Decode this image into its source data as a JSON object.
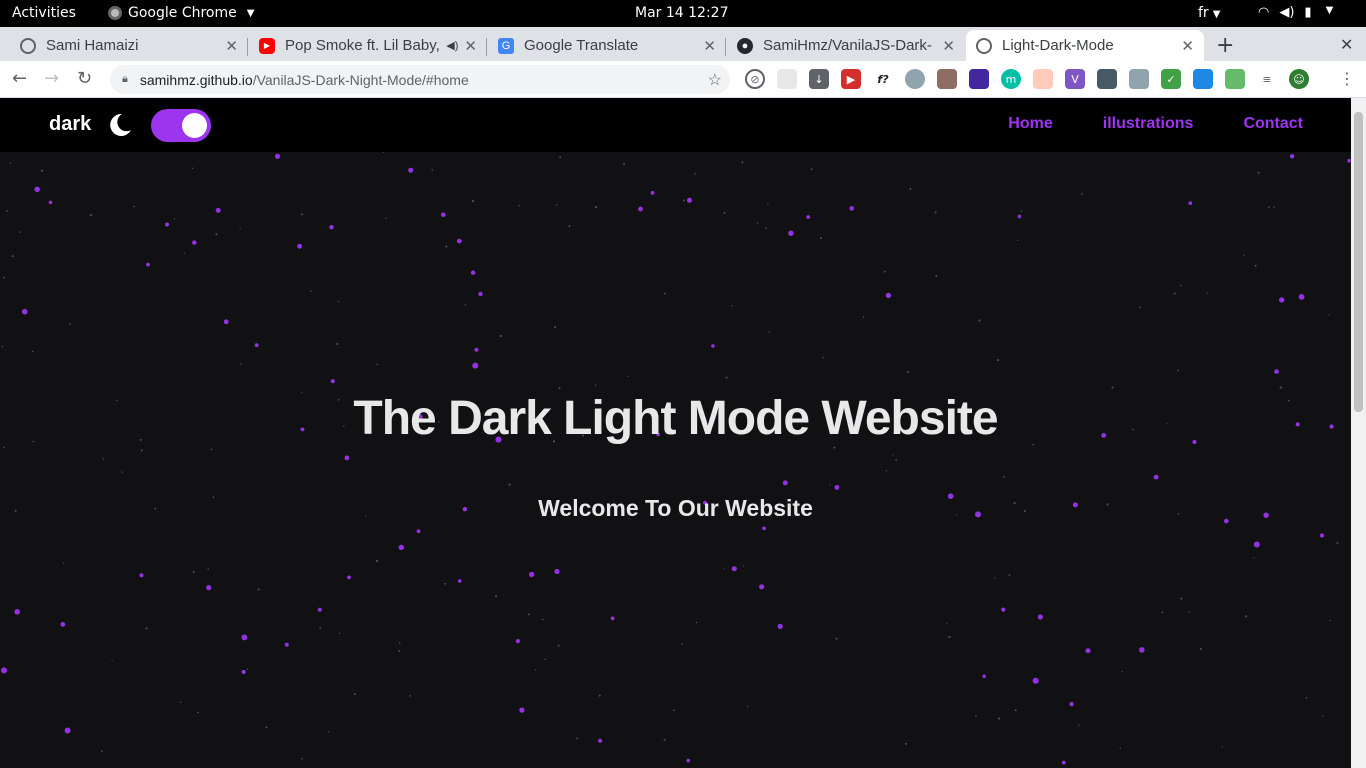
{
  "system": {
    "activities": "Activities",
    "app_name": "Google Chrome",
    "clock": "Mar 14  12:27",
    "language": "fr"
  },
  "tabs": [
    {
      "title": "Sami Hamaizi",
      "icon": "globe-icon"
    },
    {
      "title": "Pop Smoke ft. Lil Baby,",
      "icon": "youtube-icon"
    },
    {
      "title": "Google Translate",
      "icon": "translate-icon"
    },
    {
      "title": "SamiHmz/VanilaJS-Dark-",
      "icon": "github-icon"
    },
    {
      "title": "Light-Dark-Mode",
      "icon": "globe-icon",
      "active": true
    }
  ],
  "address_bar": {
    "host": "samihmz.github.io",
    "path": "/VanilaJS-Dark-Night-Mode/#home"
  },
  "site": {
    "mode_label": "dark",
    "toggle_on": true,
    "nav": [
      "Home",
      "illustrations",
      "Contact"
    ],
    "hero_title": "The Dark Light Mode Website",
    "hero_subtitle": "Welcome To Our Website"
  },
  "colors": {
    "accent": "#9d34f0",
    "page_bg": "#111113",
    "navbar_bg": "#000000",
    "text": "#e8e8e8"
  }
}
